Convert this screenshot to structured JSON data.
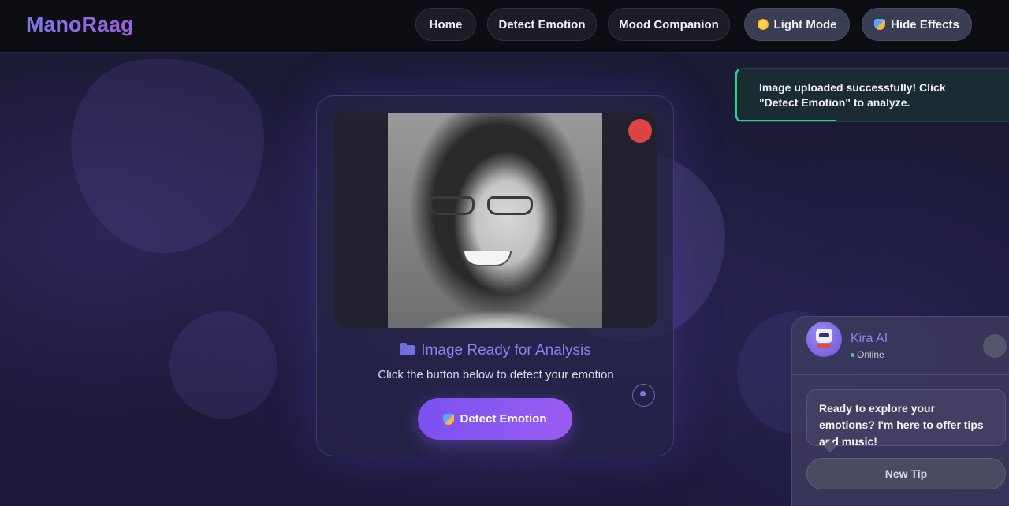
{
  "brand": "ManoRaag",
  "nav": {
    "home": "Home",
    "detect": "Detect Emotion",
    "mood": "Mood Companion",
    "light_mode": "Light Mode",
    "hide_effects": "Hide Effects"
  },
  "card": {
    "title": "Image Ready for Analysis",
    "subtitle": "Click the button below to detect your emotion",
    "detect_button": "Detect Emotion"
  },
  "toast": {
    "message": "Image uploaded successfully! Click \"Detect Emotion\" to analyze."
  },
  "chat": {
    "name": "Kira AI",
    "status": "Online",
    "message": "Ready to explore your emotions? I'm here to offer tips and music!",
    "tip_button": "New Tip"
  },
  "colors": {
    "accent": "#8a82ee",
    "button_gradient_start": "#7a52f2",
    "button_gradient_end": "#9a5cf0",
    "success": "#2fd08f",
    "record": "#e04343"
  },
  "icons": {
    "light_mode": "sun-icon",
    "hide_effects": "mask-icon",
    "card_title": "folder-icon",
    "detect_button": "mask-icon",
    "chat_avatar": "robot-icon"
  }
}
